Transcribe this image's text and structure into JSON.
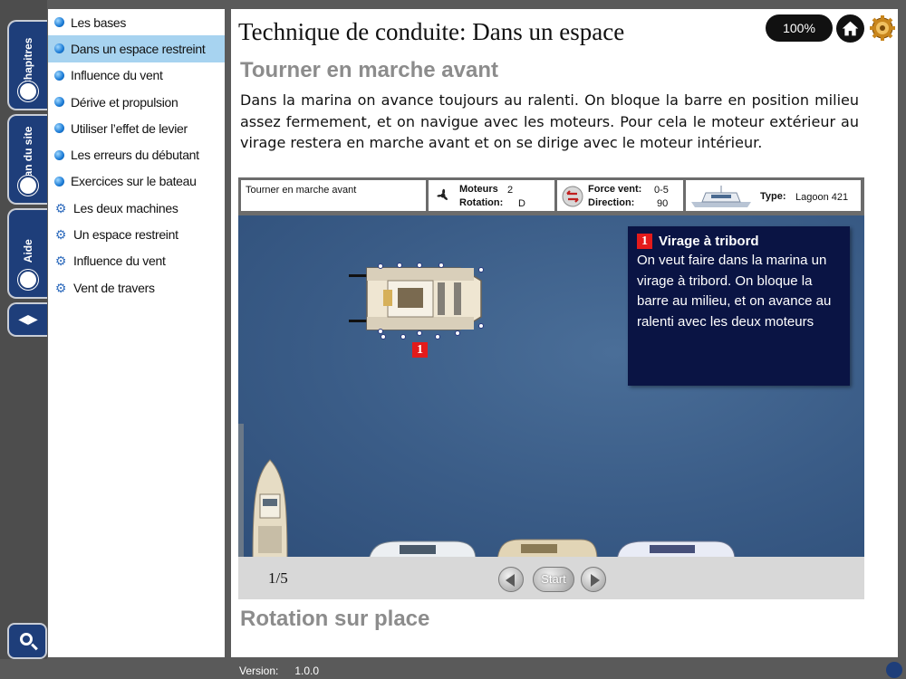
{
  "rail": {
    "chapters_label": "Chapitres",
    "sitemap_label": "Plan du site",
    "help_label": "Aide",
    "nav_arrows": "◀▶"
  },
  "sidebar": {
    "items": [
      {
        "label": "Les bases",
        "icon": "bullet"
      },
      {
        "label": "Dans un espace restreint",
        "icon": "bullet",
        "active": true
      },
      {
        "label": "Influence du vent",
        "icon": "bullet"
      },
      {
        "label": "Dérive et propulsion",
        "icon": "bullet"
      },
      {
        "label": "Utiliser l’effet de levier",
        "icon": "bullet"
      },
      {
        "label": "Les erreurs du débutant",
        "icon": "bullet"
      },
      {
        "label": "Exercices sur le bateau",
        "icon": "bullet"
      },
      {
        "label": "Les deux machines",
        "icon": "gear"
      },
      {
        "label": "Un espace restreint",
        "icon": "gear"
      },
      {
        "label": "Influence du vent",
        "icon": "gear"
      },
      {
        "label": "Vent de travers",
        "icon": "gear"
      }
    ]
  },
  "main": {
    "title": "Technique de conduite: Dans un espace",
    "zoom": "100%",
    "section1_title": "Tourner en marche avant",
    "intro": "Dans la marina on avance toujours au ralenti. On bloque la barre en position milieu assez fermement, et on navigue avec les moteurs. Pour cela le moteur extérieur au virage restera en marche avant et on se dirige avec le moteur intérieur.",
    "section2_title": "Rotation sur place"
  },
  "simulator": {
    "scenario": "Tourner en marche avant",
    "engines_label": "Moteurs",
    "engines_value": "2",
    "rotation_label": "Rotation:",
    "rotation_value": "D",
    "wind_label": "Force vent:",
    "wind_value": "0-5",
    "direction_label": "Direction:",
    "direction_value": "90",
    "type_label": "Type:",
    "type_value": "Lagoon 421",
    "info_number": "1",
    "info_title": "Virage à tribord",
    "info_text": "On veut faire dans la marina un virage à tribord. On bloque la barre au milieu, et on avance au ralenti avec les deux moteurs",
    "marker_number": "1",
    "page_count": "1/5",
    "start_label": "Start"
  },
  "footer": {
    "version_label": "Version:",
    "version_value": "1.0.0"
  },
  "colors": {
    "rail_blue": "#1e3e7a",
    "active_item": "#a7d3f0",
    "sea": "#3a5c87",
    "info_panel": "#0a1444",
    "badge_red": "#e31b1b"
  }
}
